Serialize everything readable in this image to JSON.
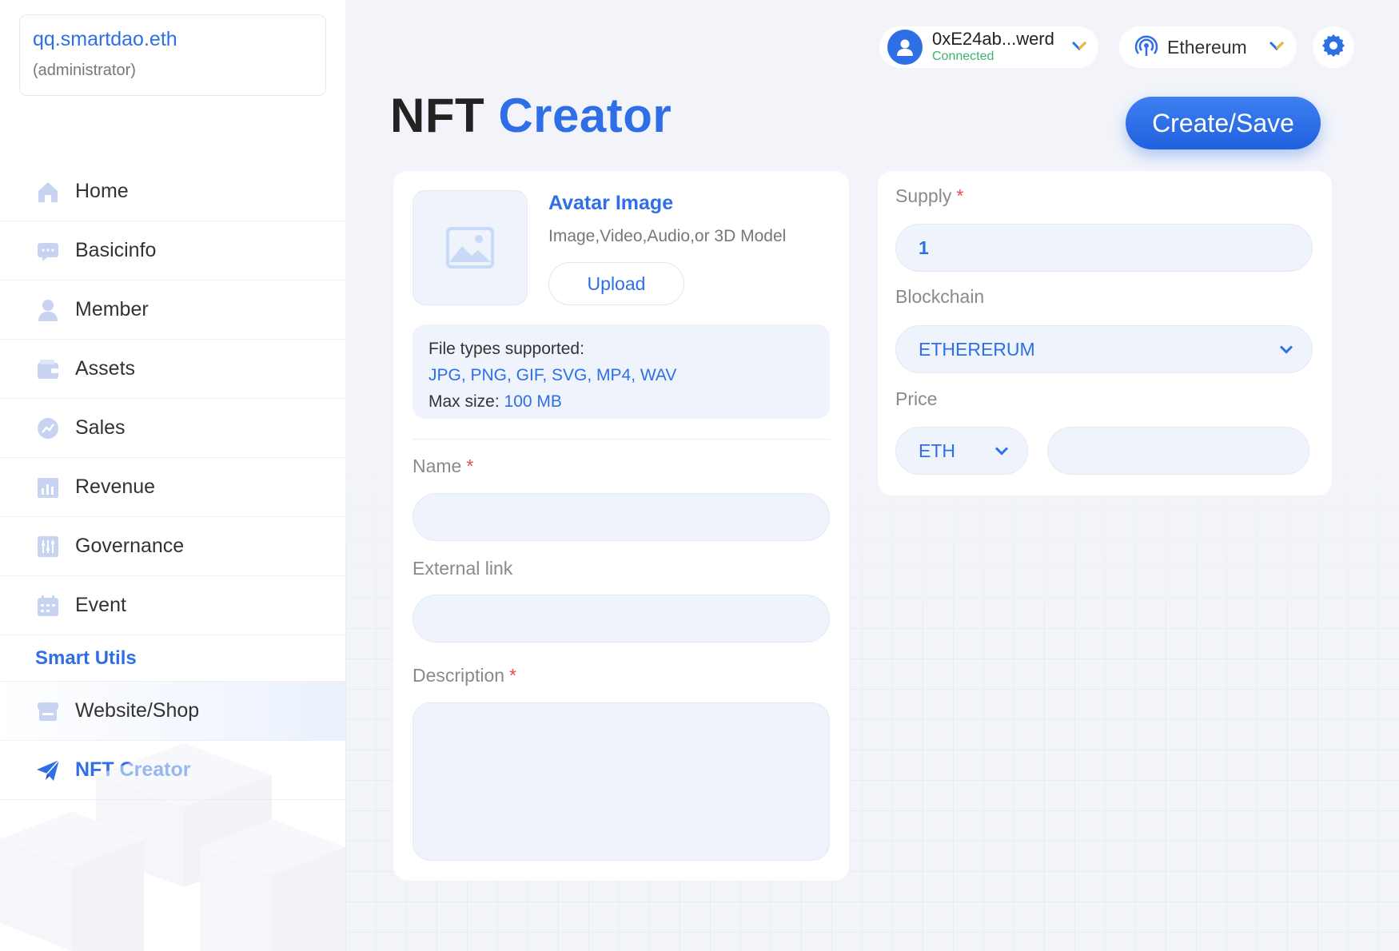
{
  "account": {
    "name": "qq.smartdao.eth",
    "role": "(administrator)"
  },
  "sidebar": {
    "items": [
      {
        "label": "Home",
        "icon": "home-icon"
      },
      {
        "label": "Basicinfo",
        "icon": "chat-icon"
      },
      {
        "label": "Member",
        "icon": "user-icon"
      },
      {
        "label": "Assets",
        "icon": "wallet-icon"
      },
      {
        "label": "Sales",
        "icon": "trend-icon"
      },
      {
        "label": "Revenue",
        "icon": "bar-chart-icon"
      },
      {
        "label": "Governance",
        "icon": "sliders-icon"
      },
      {
        "label": "Event",
        "icon": "calendar-icon"
      }
    ],
    "section_label": "Smart Utils",
    "utils": [
      {
        "label": "Website/Shop",
        "icon": "shop-icon"
      },
      {
        "label": "NFT Creator",
        "icon": "paper-plane-icon"
      }
    ]
  },
  "topbar": {
    "wallet_address": "0xE24ab...werd",
    "wallet_status": "Connected",
    "network": "Ethereum"
  },
  "page": {
    "title_part1": "NFT",
    "title_part2": "Creator",
    "create_button": "Create/Save"
  },
  "form": {
    "avatar_title": "Avatar Image",
    "avatar_subtitle": "Image,Video,Audio,or 3D Model",
    "upload_button": "Upload",
    "file_types_label": "File types supported:",
    "file_types_list": "JPG, PNG, GIF, SVG, MP4,  WAV",
    "max_size_label": "Max size:",
    "max_size_value": "100 MB",
    "name_label": "Name",
    "external_link_label": "External link",
    "description_label": "Description",
    "required_mark": "*"
  },
  "settings": {
    "supply_label": "Supply",
    "supply_value": "1",
    "blockchain_label": "Blockchain",
    "blockchain_value": "ETHERERUM",
    "price_label": "Price",
    "price_currency": "ETH"
  },
  "colors": {
    "accent": "#2f6fe6",
    "connected": "#3db36b",
    "required": "#e74b4b",
    "chevron_yellow": "#f5b82e"
  }
}
